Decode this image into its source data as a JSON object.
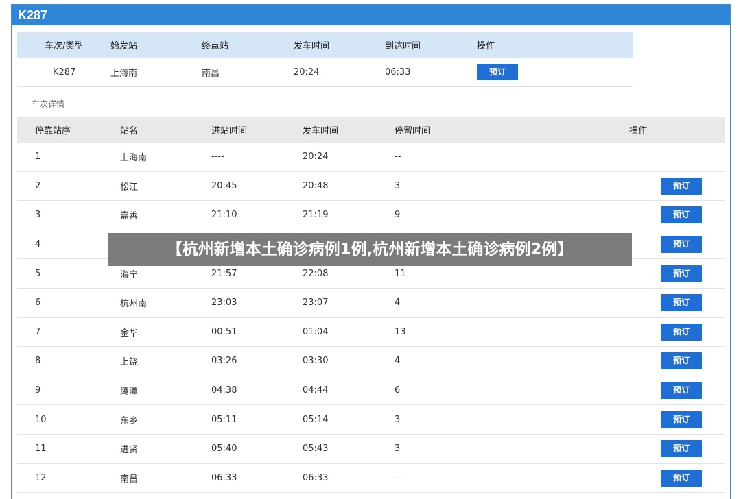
{
  "panel": {
    "title": "K287"
  },
  "summary": {
    "headers": [
      "车次/类型",
      "始发站",
      "终点站",
      "发车时间",
      "到达时间",
      "操作"
    ],
    "row": {
      "train": "K287",
      "origin": "上海南",
      "destination": "南昌",
      "depart": "20:24",
      "arrive": "06:33",
      "action": "预订"
    }
  },
  "details_label": "车次详情",
  "details": {
    "headers": [
      "停靠站序",
      "站名",
      "进站时间",
      "发车时间",
      "停留时间",
      "操作"
    ],
    "action_label": "预订",
    "rows": [
      {
        "seq": "1",
        "station": "上海南",
        "arrive": "----",
        "depart": "20:24",
        "stay": "--"
      },
      {
        "seq": "2",
        "station": "松江",
        "arrive": "20:45",
        "depart": "20:48",
        "stay": "3"
      },
      {
        "seq": "3",
        "station": "嘉善",
        "arrive": "21:10",
        "depart": "21:19",
        "stay": "9"
      },
      {
        "seq": "4",
        "station": "",
        "arrive": "",
        "depart": "",
        "stay": ""
      },
      {
        "seq": "5",
        "station": "海宁",
        "arrive": "21:57",
        "depart": "22:08",
        "stay": "11"
      },
      {
        "seq": "6",
        "station": "杭州南",
        "arrive": "23:03",
        "depart": "23:07",
        "stay": "4"
      },
      {
        "seq": "7",
        "station": "金华",
        "arrive": "00:51",
        "depart": "01:04",
        "stay": "13"
      },
      {
        "seq": "8",
        "station": "上饶",
        "arrive": "03:26",
        "depart": "03:30",
        "stay": "4"
      },
      {
        "seq": "9",
        "station": "鹰潭",
        "arrive": "04:38",
        "depart": "04:44",
        "stay": "6"
      },
      {
        "seq": "10",
        "station": "东乡",
        "arrive": "05:11",
        "depart": "05:14",
        "stay": "3"
      },
      {
        "seq": "11",
        "station": "进贤",
        "arrive": "05:40",
        "depart": "05:43",
        "stay": "3"
      },
      {
        "seq": "12",
        "station": "南昌",
        "arrive": "06:33",
        "depart": "06:33",
        "stay": "--"
      }
    ]
  },
  "banner": {
    "text": "【杭州新增本土确诊病例1例,杭州新增本土确诊病例2例】"
  },
  "colors": {
    "header": "#2f86d6",
    "button": "#1f6ed4",
    "summary_head": "#d5e7f7",
    "details_head": "#e9e9e9"
  }
}
